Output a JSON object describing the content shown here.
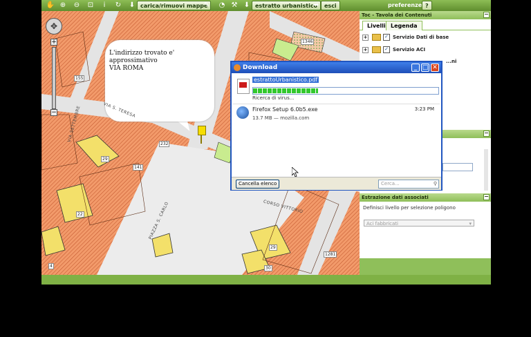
{
  "toolbar": {
    "icons": [
      "pan-hand-icon",
      "zoom-in-icon",
      "zoom-out-icon",
      "zoom-box-icon",
      "info-icon",
      "refresh-icon",
      "download-icon"
    ],
    "load_maps_label": "carica/rimuovi mappe",
    "urban_extract_label": "estratto urbanistico",
    "exit_label": "esci",
    "preferences_label": "preferenze",
    "help_label": "?"
  },
  "map": {
    "callout_line1": "L'indirizzo trovato e' approssimativo",
    "callout_line2": "VIA ROMA",
    "parcel_labels": [
      "155",
      "1346",
      "29",
      "22",
      "232",
      "29",
      "30",
      "1281",
      "141",
      "4"
    ],
    "streets": [
      "VIA S. TERESA",
      "PIAZZA S. CARLO",
      "CORSO VITTORIO",
      "VIA SETTEMBRE"
    ]
  },
  "toc": {
    "title": "Toc - Tavola dei Contenuti",
    "tabs": [
      "Livelli",
      "Legenda"
    ],
    "layers": [
      {
        "label": "Servizio Dati di base",
        "checked": true
      },
      {
        "label": "Servizio ACI",
        "checked": true
      },
      {
        "label": "...ni",
        "checked": false
      }
    ]
  },
  "extraction": {
    "title": "Estrazione dati associati",
    "hint": "Definisci livello per selezione poligono",
    "select_value": "Aci fabbricati"
  },
  "download_dialog": {
    "title": "Download",
    "items": [
      {
        "name": "estrattoUrbanistico.pdf",
        "status": "Ricerca di virus...",
        "progress": 0.35
      },
      {
        "name": "Firefox Setup 6.0b5.exe",
        "meta": "13.7 MB — mozilla.com",
        "time": "3:23 PM"
      }
    ],
    "clear_label": "Cancella elenco",
    "search_placeholder": "Cerca..."
  },
  "colors": {
    "toolbar_green": "#7aa84a",
    "parcel_orange": "#f29a6a",
    "highlight_yellow": "#f3e06a",
    "dialog_blue": "#2055c0"
  }
}
